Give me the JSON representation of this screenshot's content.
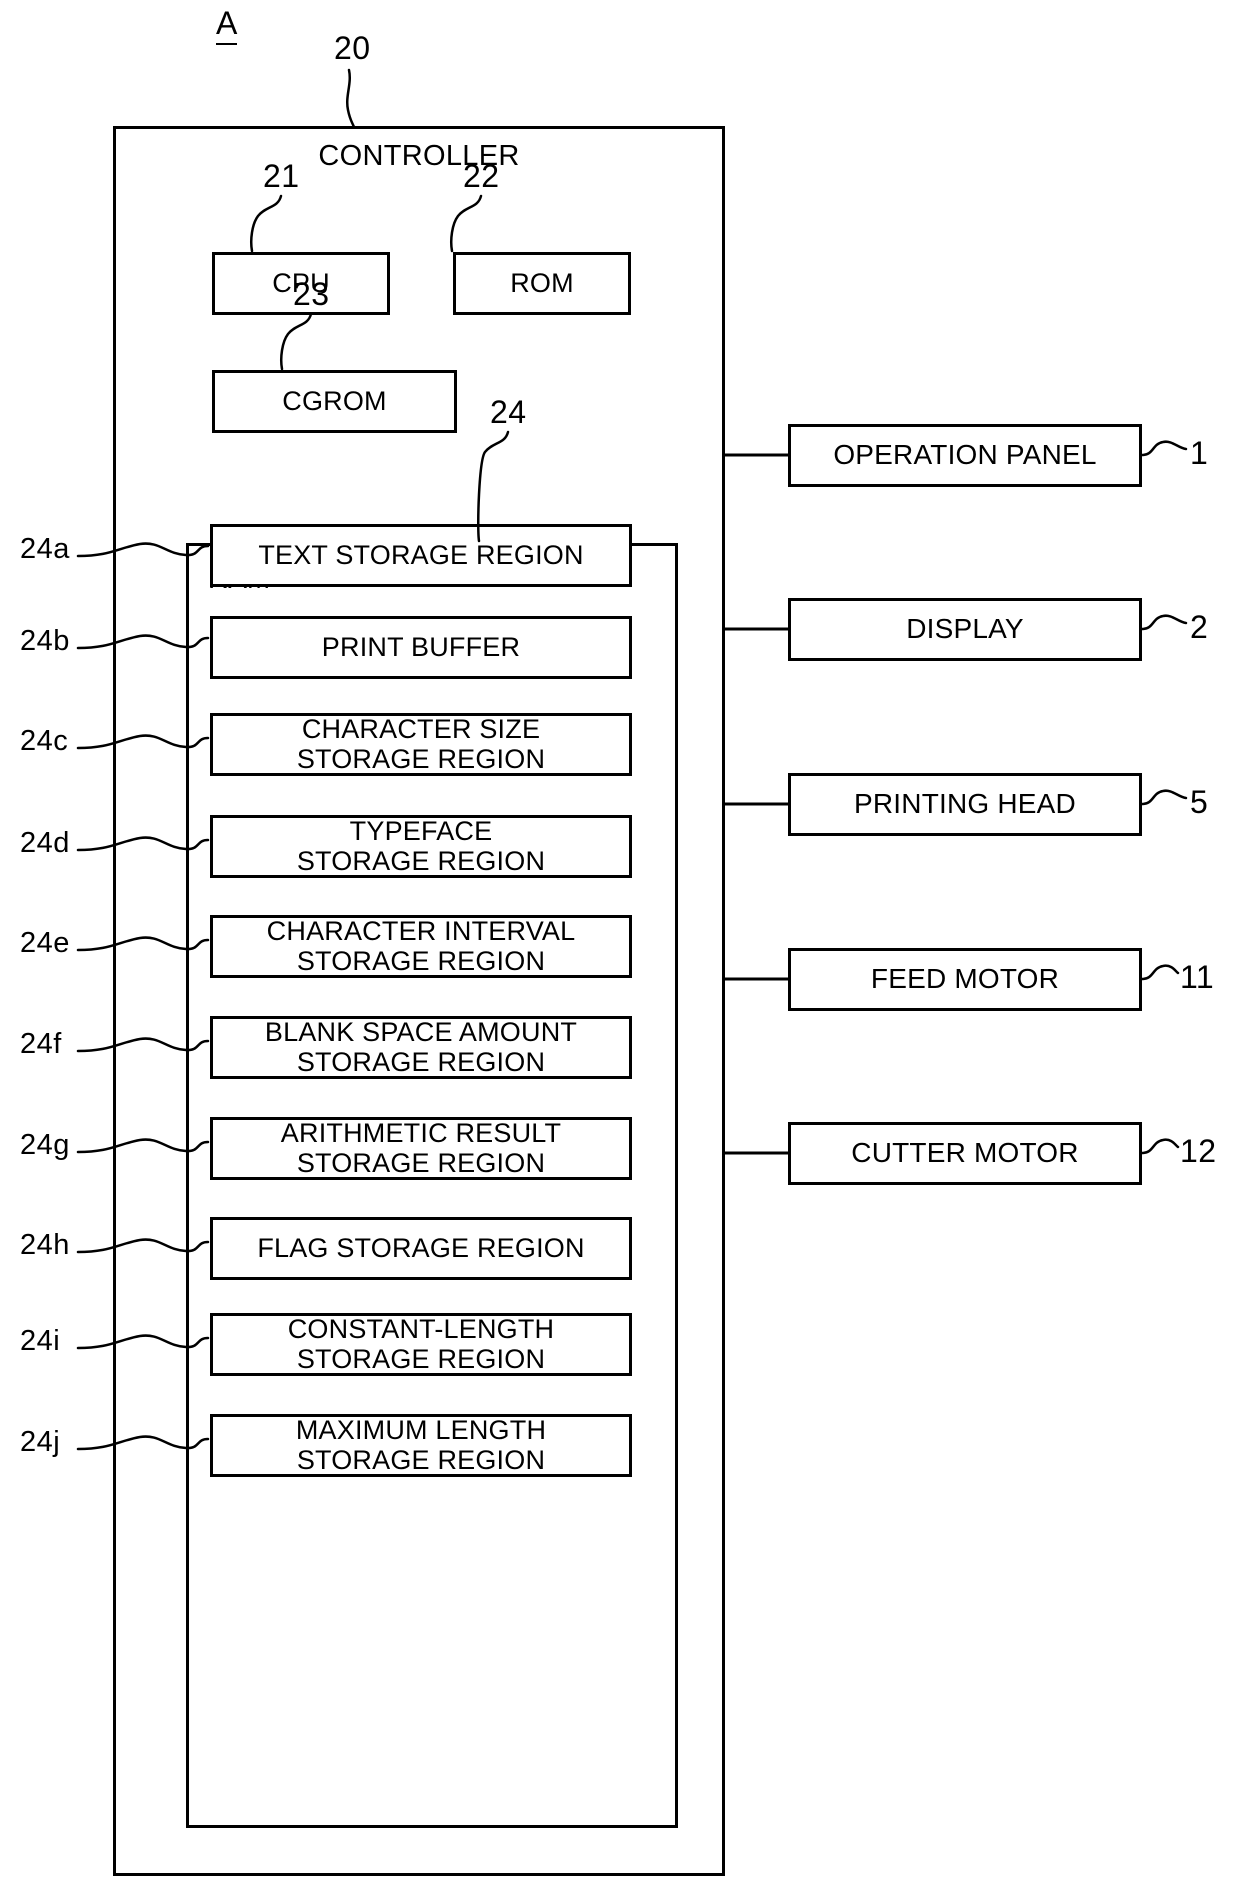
{
  "figure": {
    "part_letter": "A",
    "controller_ref": "20",
    "controller_title": "CONTROLLER",
    "ram_title": "RAM",
    "ram_ref": "24"
  },
  "core_blocks": [
    {
      "id": "cpu",
      "label": "CPU",
      "ref": "21"
    },
    {
      "id": "rom",
      "label": "ROM",
      "ref": "22"
    },
    {
      "id": "cgrom",
      "label": "CGROM",
      "ref": "23"
    }
  ],
  "storage_regions": [
    {
      "ref": "24a",
      "label": "TEXT STORAGE REGION"
    },
    {
      "ref": "24b",
      "label": "PRINT BUFFER"
    },
    {
      "ref": "24c",
      "label": "CHARACTER SIZE\nSTORAGE REGION"
    },
    {
      "ref": "24d",
      "label": "TYPEFACE\nSTORAGE REGION"
    },
    {
      "ref": "24e",
      "label": "CHARACTER INTERVAL\nSTORAGE REGION"
    },
    {
      "ref": "24f",
      "label": "BLANK SPACE AMOUNT\nSTORAGE REGION"
    },
    {
      "ref": "24g",
      "label": "ARITHMETIC RESULT\nSTORAGE REGION"
    },
    {
      "ref": "24h",
      "label": "FLAG STORAGE REGION"
    },
    {
      "ref": "24i",
      "label": "CONSTANT-LENGTH\nSTORAGE REGION"
    },
    {
      "ref": "24j",
      "label": "MAXIMUM LENGTH\nSTORAGE REGION"
    }
  ],
  "peripherals": [
    {
      "ref": "1",
      "label": "OPERATION PANEL"
    },
    {
      "ref": "2",
      "label": "DISPLAY"
    },
    {
      "ref": "5",
      "label": "PRINTING HEAD"
    },
    {
      "ref": "11",
      "label": "FEED MOTOR"
    },
    {
      "ref": "12",
      "label": "CUTTER MOTOR"
    }
  ],
  "colors": {
    "stroke": "#000000",
    "background": "#ffffff"
  }
}
